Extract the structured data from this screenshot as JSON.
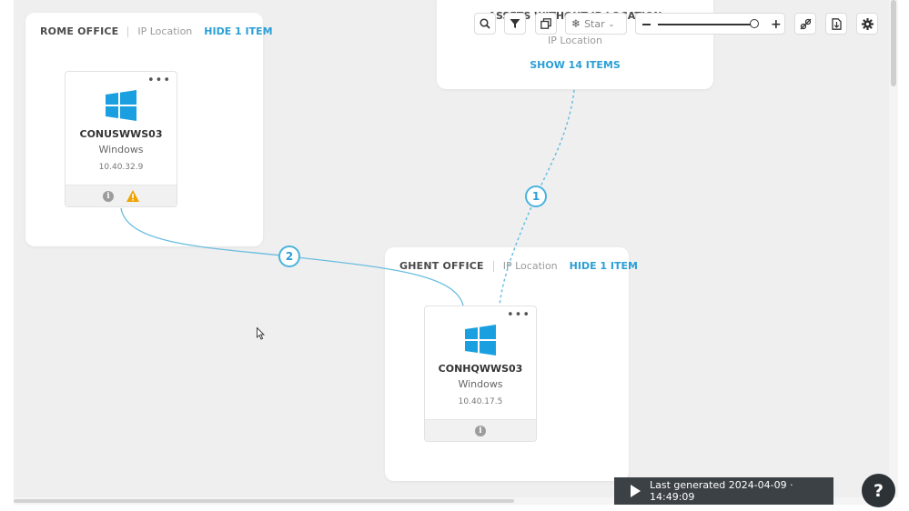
{
  "groups": [
    {
      "name": "ROME OFFICE",
      "type": "IP Location",
      "action": "HIDE 1 ITEM"
    },
    {
      "name": "GHENT OFFICE",
      "type": "IP Location",
      "action": "HIDE 1 ITEM"
    },
    {
      "name": "ASSETS WITHOUT IP LOCATION",
      "type": "IP Location",
      "action": "SHOW 14 ITEMS"
    }
  ],
  "assets": [
    {
      "name": "CONUSWWS03",
      "os": "Windows",
      "ip": "10.40.32.9",
      "has_warning": true
    },
    {
      "name": "CONHQWWS03",
      "os": "Windows",
      "ip": "10.40.17.5",
      "has_warning": false
    }
  ],
  "badges": [
    "1",
    "2"
  ],
  "toolbar": {
    "layout_select": "Star",
    "zoom_level": 0.92
  },
  "status": {
    "last_generated": "Last generated 2024-04-09 · 14:49:09"
  },
  "help": {
    "label": "?"
  },
  "colors": {
    "accent": "#2a9fd6",
    "connector": "#6bbde0",
    "dark_bar": "#3c4146",
    "windows_blue": "#1aa0e0",
    "warning": "#f0a400"
  }
}
